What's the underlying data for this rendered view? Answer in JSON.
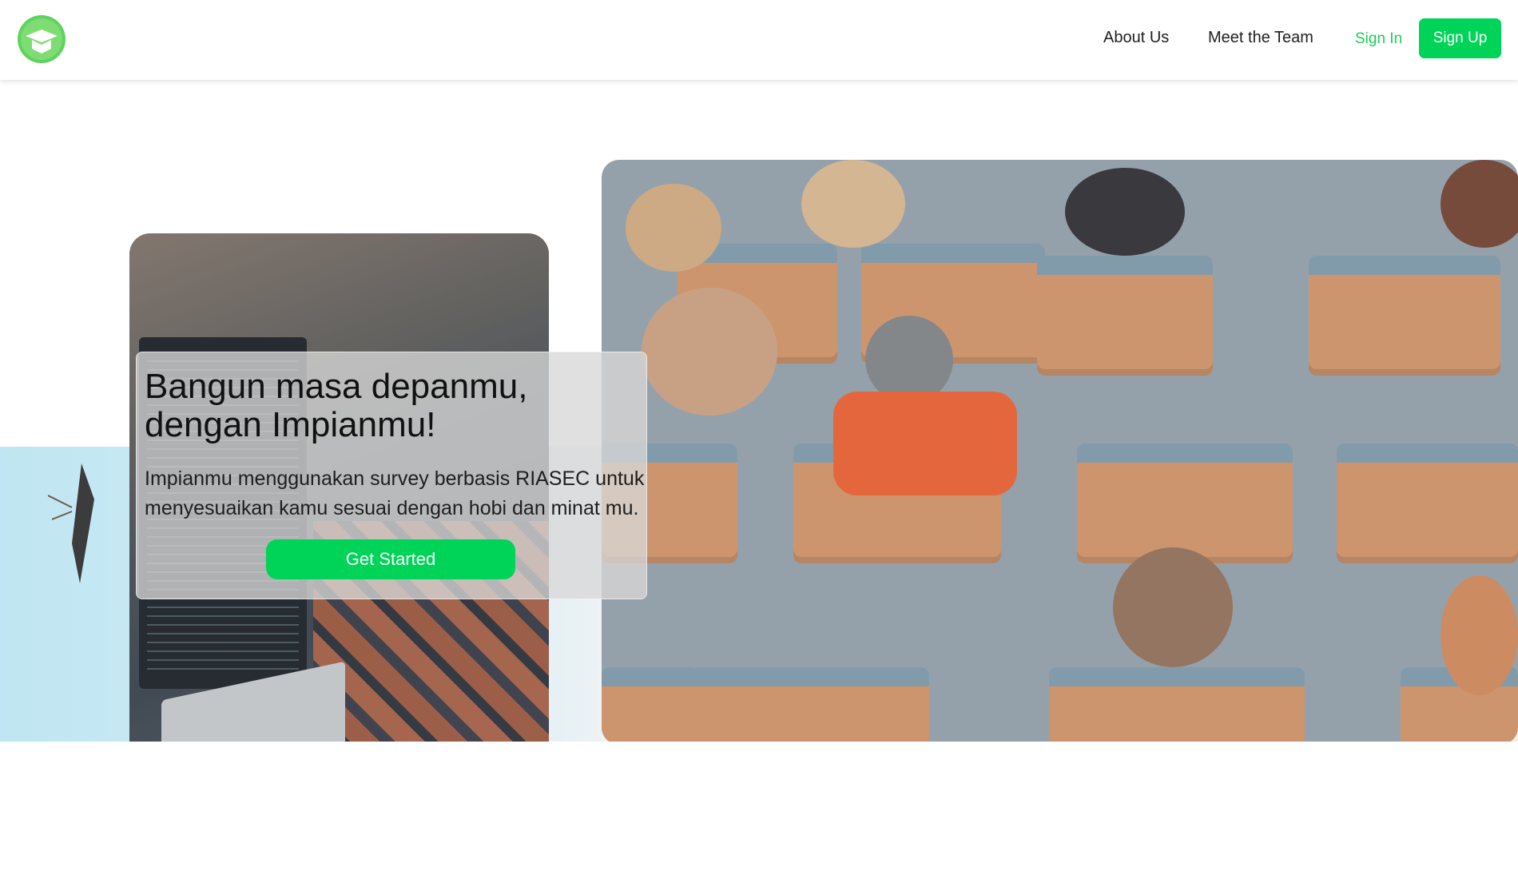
{
  "nav": {
    "links": [
      "About Us",
      "Meet the Team"
    ],
    "signin_label": "Sign In",
    "signup_label": "Sign Up",
    "logo_icon": "graduation-cap-logo-icon"
  },
  "hero": {
    "title_line1": "Bangun masa depanmu,",
    "title_line2": "dengan Impianmu!",
    "description_line1": "Impianmu menggunakan survey berbasis RIASEC untuk",
    "description_line2": "menyesuaikan kamu sesuai dengan hobi dan minat mu.",
    "cta_label": "Get Started"
  },
  "colors": {
    "accent": "#00d458",
    "signin_text": "#1ecc58"
  }
}
